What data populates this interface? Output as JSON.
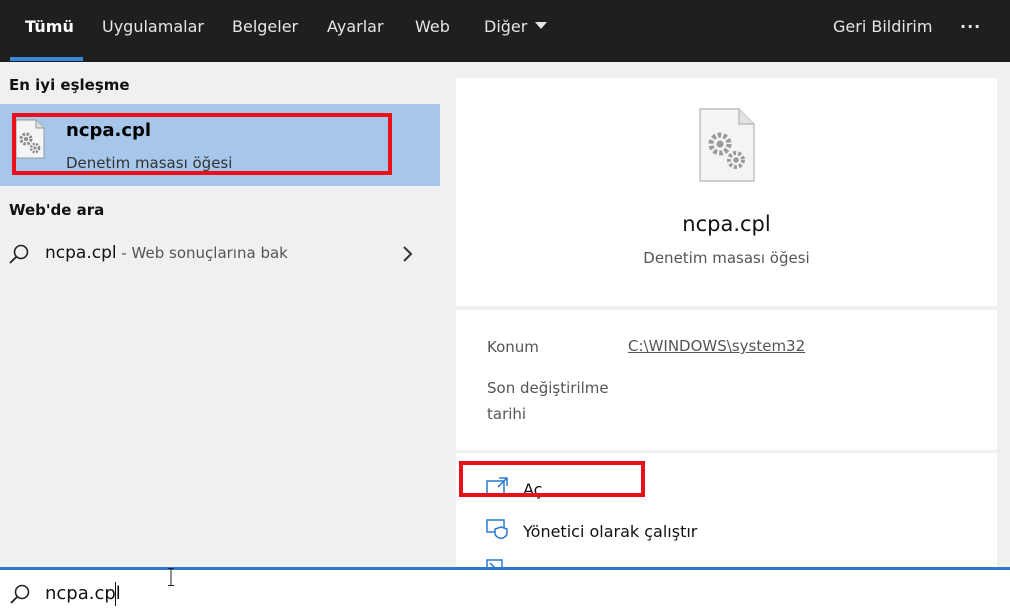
{
  "nav": {
    "tabs": [
      "Tümü",
      "Uygulamalar",
      "Belgeler",
      "Ayarlar",
      "Web",
      "Diğer"
    ],
    "feedback": "Geri Bildirim",
    "more": "···"
  },
  "left": {
    "best_match_label": "En iyi eşleşme",
    "best_match": {
      "title": "ncpa.cpl",
      "subtitle": "Denetim masası öğesi"
    },
    "web_label": "Web'de ara",
    "web_query": "ncpa.cpl",
    "web_hint": " - Web sonuçlarına bak"
  },
  "detail": {
    "title": "ncpa.cpl",
    "subtitle": "Denetim masası öğesi",
    "location_label": "Konum",
    "location_value": "C:\\WINDOWS\\system32",
    "modified_label_1": "Son değiştirilme",
    "modified_label_2": "tarihi",
    "actions": [
      "Aç",
      "Yönetici olarak çalıştır"
    ]
  },
  "search": {
    "value": "ncpa.cpl"
  },
  "colors": {
    "highlight": "#e8111a",
    "selected": "#a6c7ea",
    "accent": "#2a78cf"
  }
}
